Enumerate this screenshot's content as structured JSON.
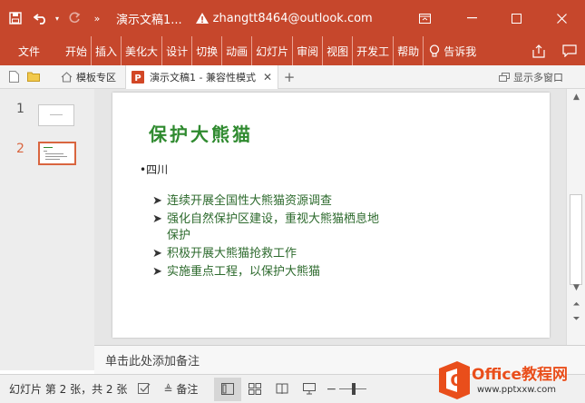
{
  "titlebar": {
    "doc_title": "演示文稿1...",
    "account": "zhangtt8464@outlook.com"
  },
  "ribbon": {
    "tabs": [
      "文件",
      "开始",
      "插入",
      "美化大",
      "设计",
      "切换",
      "动画",
      "幻灯片",
      "审阅",
      "视图",
      "开发工",
      "帮助"
    ],
    "tell_me": "告诉我"
  },
  "tabbar": {
    "template_tab": "模板专区",
    "doc_tab": "演示文稿1 - 兼容性模式",
    "multi_window": "显示多窗口"
  },
  "thumbnails": {
    "numbers": [
      "1",
      "2"
    ],
    "selected": 2
  },
  "slide": {
    "title": "保护大熊猫",
    "level1": "•四川",
    "bullets": [
      "连续开展全国性大熊猫资源调查",
      "强化自然保护区建设，重视大熊猫栖息地",
      "保护",
      "积极开展大熊猫抢救工作",
      "实施重点工程，以保护大熊猫"
    ]
  },
  "notes": {
    "placeholder": "单击此处添加备注"
  },
  "statusbar": {
    "slide_info": "幻灯片 第 2 张，共 2 张",
    "notes_label": "备注"
  },
  "watermark": {
    "brand": "Office教程网",
    "url": "www.pptxxw.com",
    "letter": "O"
  },
  "colors": {
    "accent": "#c6472c",
    "title_green": "#2f8a2f",
    "text_green": "#2d6a2d"
  }
}
